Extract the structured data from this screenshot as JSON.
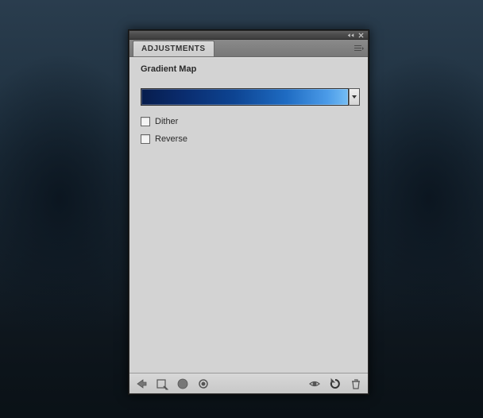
{
  "panel": {
    "tab_label": "ADJUSTMENTS",
    "heading": "Gradient Map",
    "options": {
      "dither_label": "Dither",
      "reverse_label": "Reverse"
    },
    "gradient": {
      "stops": [
        "#071d4d",
        "#0d4492",
        "#4b9be8",
        "#74bdf4"
      ]
    },
    "footer_icons": {
      "back": "back-arrow",
      "list": "adjustments-list",
      "wide": "expanded-view",
      "clip": "clip-to-layer",
      "prev": "previous-state",
      "reset": "reset-defaults",
      "trash": "delete-adjustment"
    }
  }
}
